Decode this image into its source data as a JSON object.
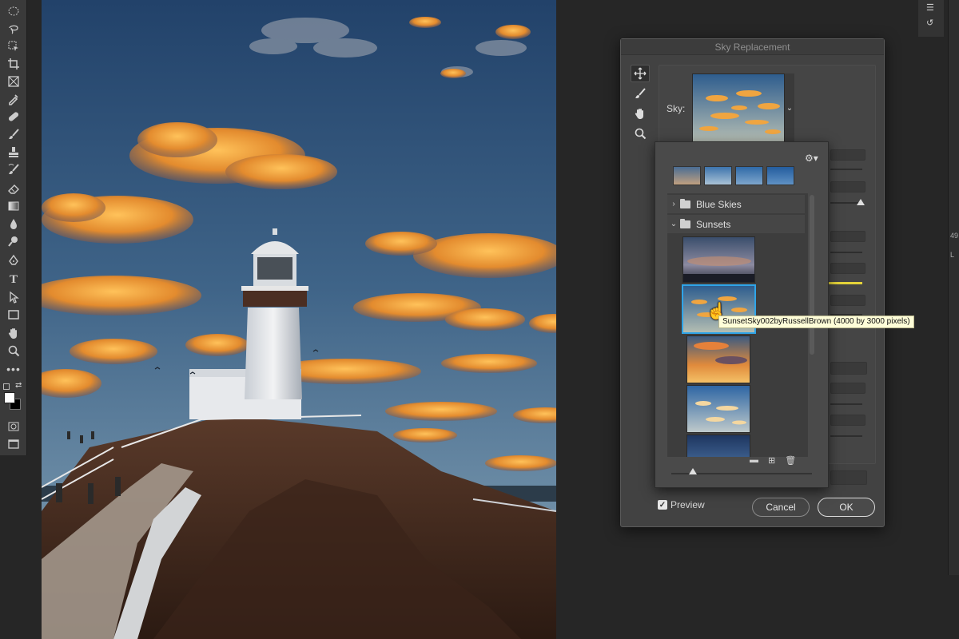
{
  "dialog": {
    "title": "Sky Replacement",
    "sky_label": "Sky:",
    "preview_label": "Preview",
    "preview_checked": true,
    "cancel_label": "Cancel",
    "ok_label": "OK"
  },
  "tools": [
    "marquee-icon",
    "lasso-icon",
    "object-select-icon",
    "crop-icon",
    "frame-icon",
    "eyedropper-icon",
    "healing-icon",
    "brush-icon",
    "stamp-icon",
    "history-brush-icon",
    "eraser-icon",
    "gradient-icon",
    "blur-icon",
    "dodge-icon",
    "pen-icon",
    "type-icon",
    "path-select-icon",
    "rectangle-icon",
    "hand-icon",
    "zoom-icon",
    "more-icon"
  ],
  "dialog_tools": [
    "move-sky-icon",
    "sky-brush-icon",
    "hand-icon",
    "zoom-icon"
  ],
  "colors": {
    "foreground": "#ffffff",
    "background": "#000000",
    "selection": "#2fa4e7",
    "accent_slider": "#e4d33a"
  },
  "sky_presets": {
    "folders": [
      {
        "name": "Blue Skies",
        "expanded": false
      },
      {
        "name": "Sunsets",
        "expanded": true
      }
    ],
    "tooltip": "SunsetSky002byRussellBrown (4000 by 3000 pixels)",
    "selected_index": 1
  },
  "right_panel": {
    "text_a": "49",
    "text_b": "L"
  }
}
